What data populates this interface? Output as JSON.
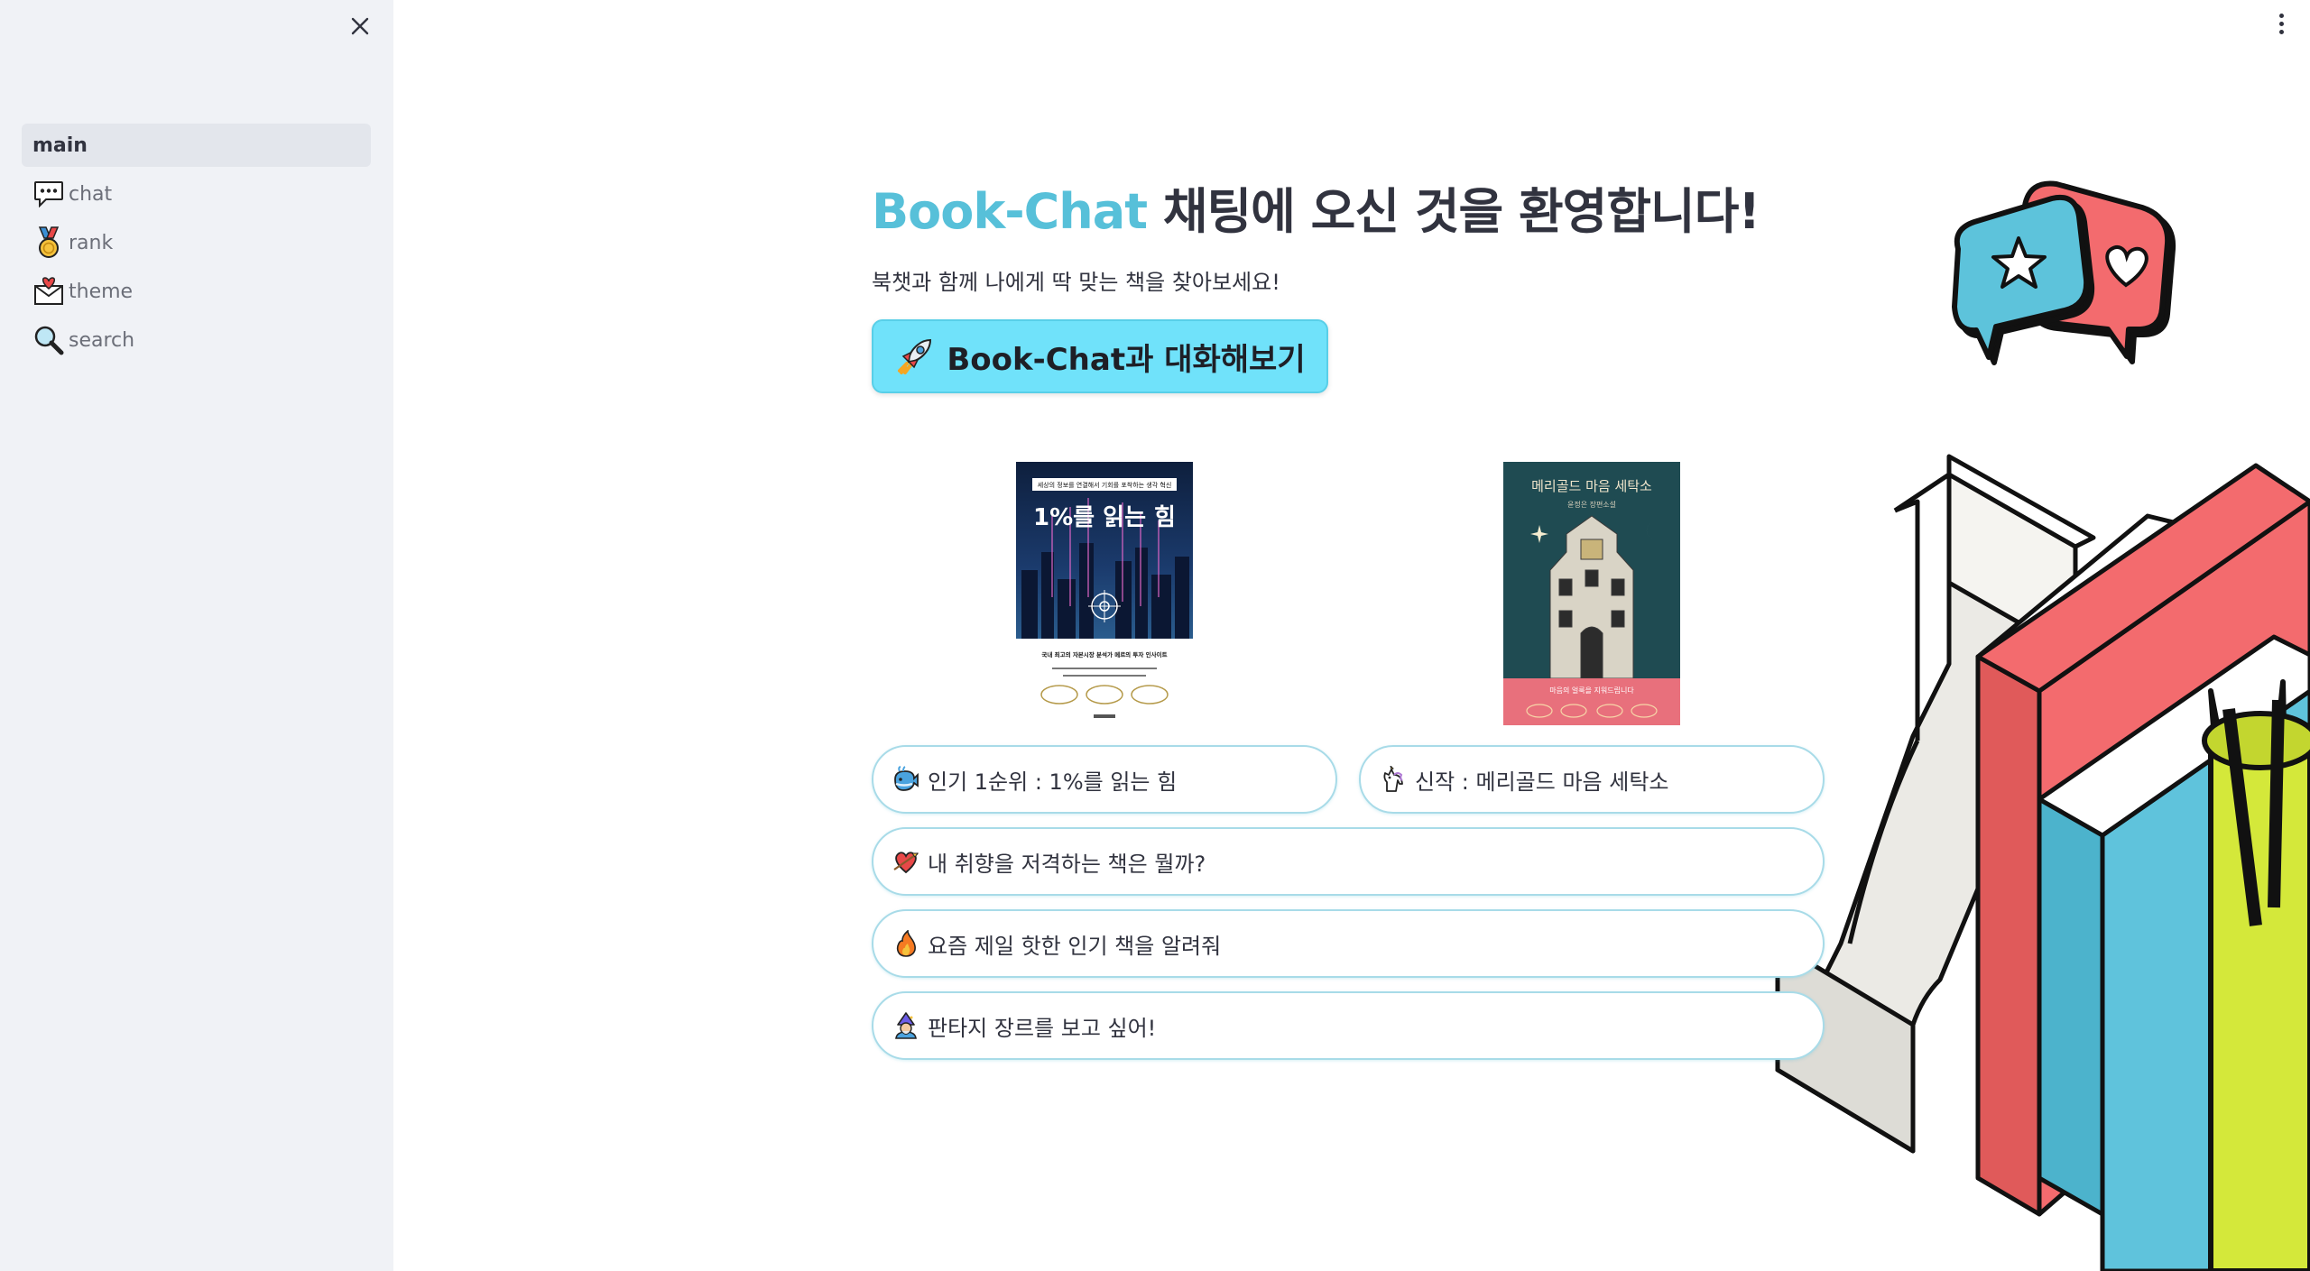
{
  "sidebar": {
    "items": [
      {
        "label": "main",
        "icon": "none",
        "active": true
      },
      {
        "label": "chat",
        "icon": "speech-bubble-icon"
      },
      {
        "label": "rank",
        "icon": "medal-icon"
      },
      {
        "label": "theme",
        "icon": "love-letter-icon"
      },
      {
        "label": "search",
        "icon": "magnifier-icon"
      }
    ]
  },
  "hero": {
    "brand": "Book-Chat",
    "title_rest": " 채팅에 오신 것을 환영합니다!",
    "subtitle": "북챗과 함께 나에게 딱 맞는 책을 찾아보세요!",
    "cta_label": "Book-Chat과 대화해보기",
    "cta_icon": "rocket-icon"
  },
  "books": [
    {
      "cover_top_text": "세상의 정보를 연결해서 기회를 포착하는 생각 혁신",
      "cover_title": "1%를 읽는 힘",
      "cover_bottom_text": "국내 최고의 자본시장 분석가 메르의 투자 인사이트"
    },
    {
      "cover_title": "메리골드 마음 세탁소",
      "cover_subtitle": "윤정은 장편소설",
      "cover_bottom_text": "마음의 얼룩을 지워드립니다"
    }
  ],
  "suggestions": [
    {
      "label": "인기 1순위 : 1%를 읽는 힘",
      "icon": "whale-icon"
    },
    {
      "label": "신작 : 메리골드 마음 세탁소",
      "icon": "unicorn-icon"
    },
    {
      "label": "내 취향을 저격하는 책은 뭘까?",
      "icon": "heart-arrow-icon"
    },
    {
      "label": "요즘 제일 핫한 인기 책을 알려줘",
      "icon": "fire-icon"
    },
    {
      "label": "판타지 장르를 보고 싶어!",
      "icon": "mage-icon"
    }
  ],
  "colors": {
    "accent": "#57c0d9",
    "cta_bg": "#70e2fa",
    "sidebar_bg": "#f0f2f6",
    "coral": "#f26b6b",
    "book_blue": "#5fc3dc",
    "cup_yellow": "#d4e83a"
  }
}
